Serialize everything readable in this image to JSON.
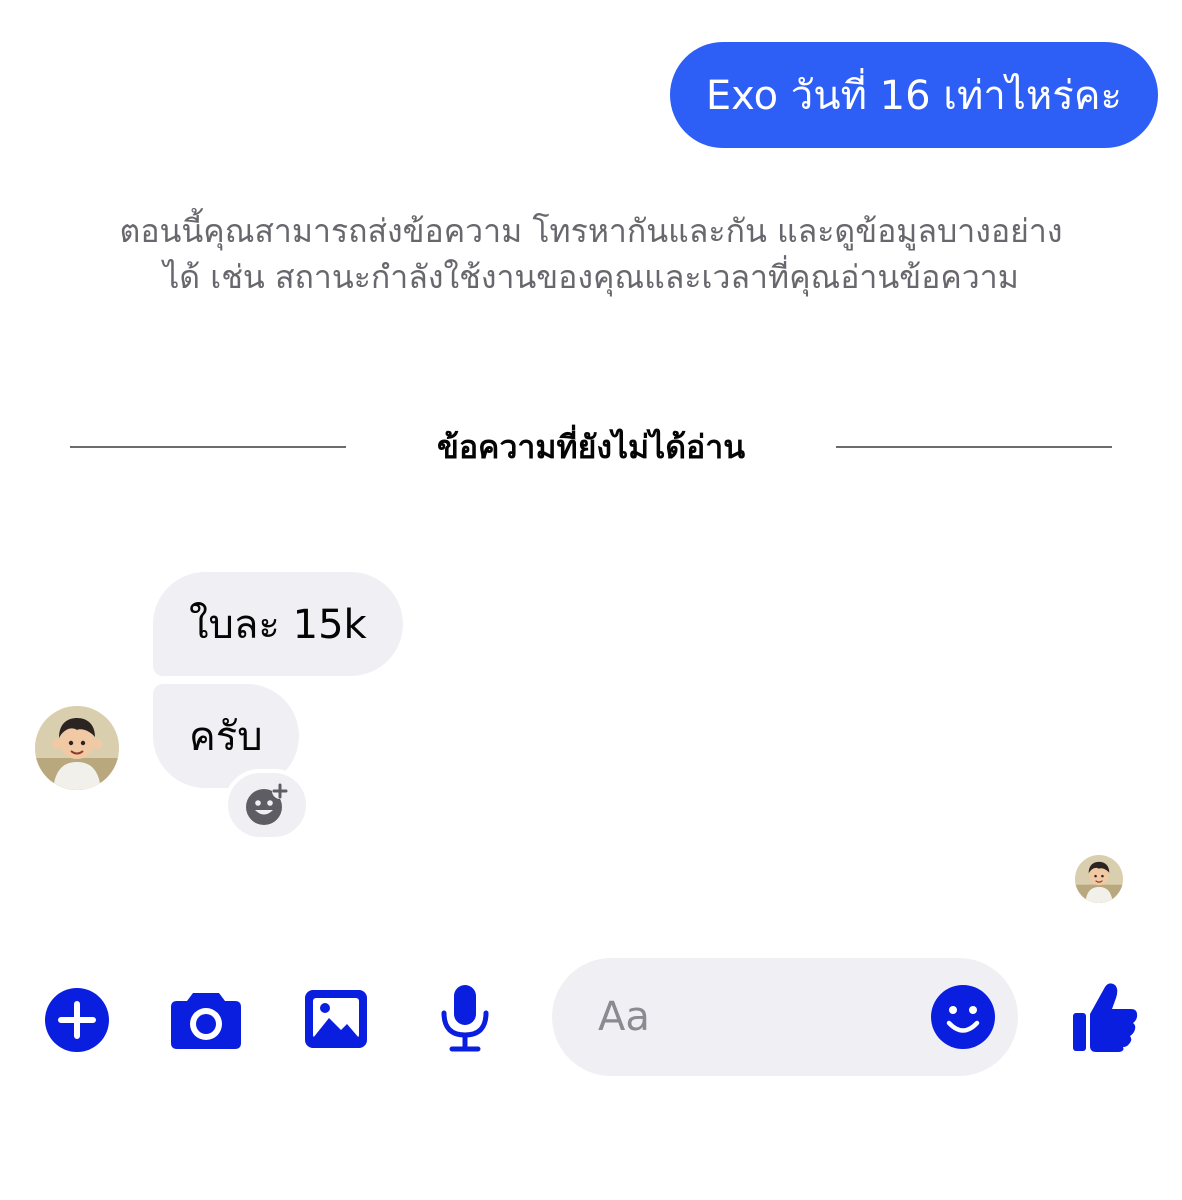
{
  "thread": {
    "outgoing_message": "Exo วันที่ 16 เท่าไหร่คะ",
    "system_notice": [
      "ตอนนี้คุณสามารถส่งข้อความ โทรหากันและกัน และดูข้อมูลบางอย่าง",
      "ได้ เช่น สถานะกำลังใช้งานของคุณและเวลาที่คุณอ่านข้อความ"
    ],
    "unread_divider": "ข้อความที่ยังไม่ได้อ่าน",
    "incoming_messages": [
      "ใบละ 15k",
      "ครับ"
    ]
  },
  "composer": {
    "placeholder": "Aa",
    "icons": [
      "plus-icon",
      "camera-icon",
      "image-icon",
      "microphone-icon",
      "emoji-icon",
      "thumbs-up-icon"
    ]
  },
  "colors": {
    "outgoing_bubble": "#2d5ef6",
    "incoming_bubble": "#f0f0f4",
    "accent_icon": "#0a1ee0",
    "notice_text": "#67676d"
  }
}
